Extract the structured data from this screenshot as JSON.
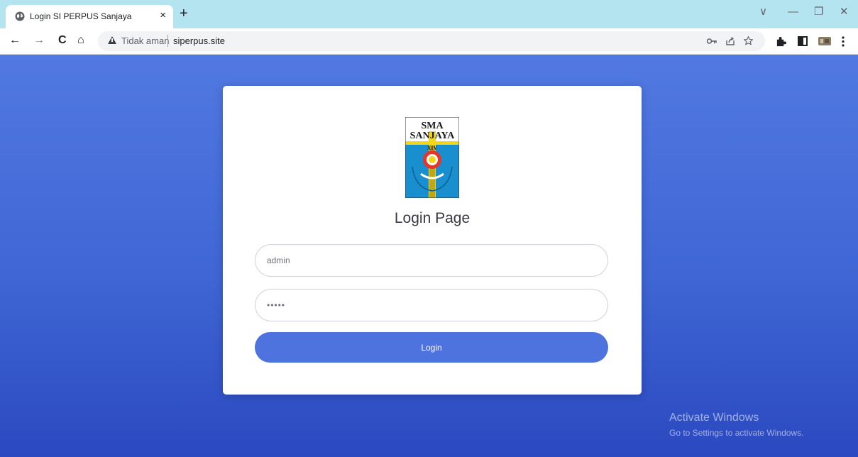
{
  "browser": {
    "tab": {
      "title": "Login SI PERPUS Sanjaya",
      "close_glyph": "×",
      "icon": "globe-icon"
    },
    "new_tab_glyph": "+",
    "window_controls": {
      "dropdown": "∨",
      "minimize": "—",
      "restore": "❐",
      "close": "✕"
    },
    "nav": {
      "back": "←",
      "forward": "→",
      "reload": "C",
      "home": "⌂"
    },
    "address": {
      "security_label": "Tidak aman",
      "url": "siperpus.site"
    },
    "toolbar_icons": [
      "key-icon",
      "share-icon",
      "star-icon",
      "extensions-icon",
      "sidepanel-icon",
      "profile-icon",
      "menu-icon"
    ]
  },
  "login": {
    "logo_text": {
      "line1": "SMA",
      "line2": "SANJAYA",
      "line3": "XIV"
    },
    "heading": "Login Page",
    "username_value": "admin",
    "password_value": "•••••",
    "button_label": "Login"
  },
  "watermark": {
    "title": "Activate Windows",
    "subtitle": "Go to Settings to activate Windows."
  },
  "colors": {
    "tabstrip": "#b5e4f1",
    "accent": "#4e73df",
    "bg_top": "#5179e1",
    "bg_bottom": "#2b49c0"
  }
}
